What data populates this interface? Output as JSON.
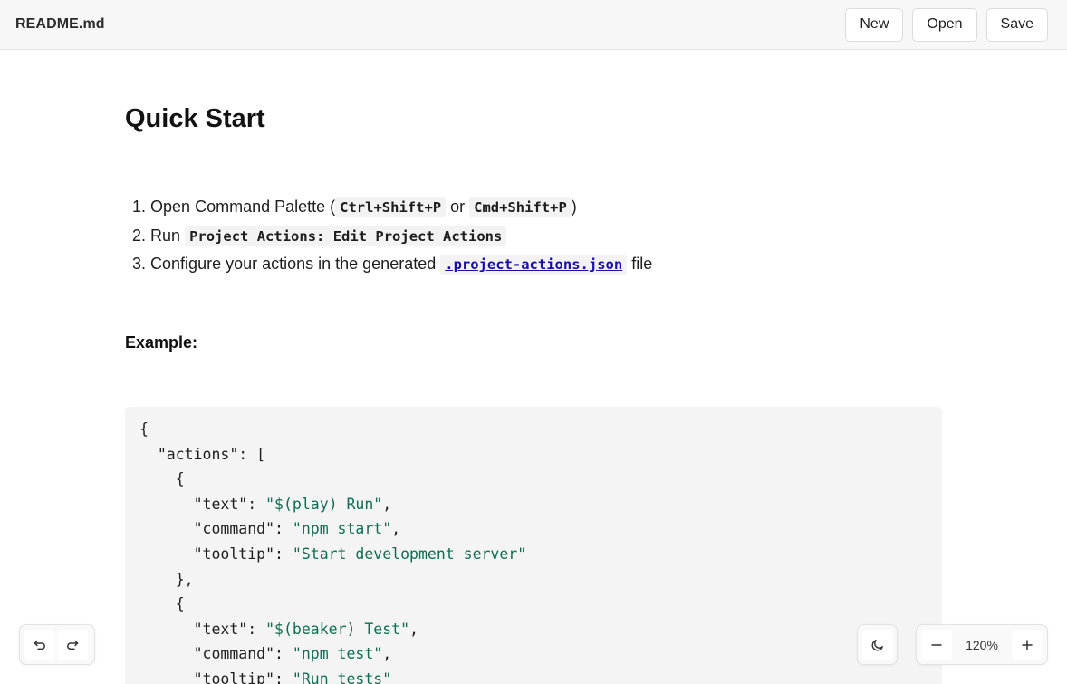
{
  "header": {
    "file_title": "README.md",
    "buttons": {
      "new": "New",
      "open": "Open",
      "save": "Save"
    }
  },
  "doc": {
    "heading": "Quick Start",
    "steps": [
      {
        "num": "1.",
        "pre": "Open Command Palette (",
        "code1": "Ctrl+Shift+P",
        "mid": " or ",
        "code2": "Cmd+Shift+P",
        "post": ")"
      },
      {
        "num": "2.",
        "pre": "Run ",
        "code1": "Project Actions: Edit Project Actions"
      },
      {
        "num": "3.",
        "pre": "Configure your actions in the generated ",
        "link": ".project-actions.json",
        "post": " file"
      }
    ],
    "example_label": "Example:",
    "code": {
      "open_brace": "{",
      "actions_key": "\"actions\"",
      "actions_open": ": [",
      "item_open": "{",
      "item_close_comma": "},",
      "text_key": "\"text\"",
      "command_key": "\"command\"",
      "tooltip_key": "\"tooltip\"",
      "item1": {
        "text": "\"$(play) Run\"",
        "command": "\"npm start\"",
        "tooltip": "\"Start development server\""
      },
      "item2": {
        "text": "\"$(beaker) Test\"",
        "command": "\"npm test\"",
        "tooltip": "\"Run tests\""
      }
    }
  },
  "controls": {
    "zoom_level": "120%",
    "icons": {
      "undo": "undo-icon",
      "redo": "redo-icon",
      "theme": "moon-icon",
      "zoom_out": "minus-icon",
      "zoom_in": "plus-icon"
    }
  },
  "colors": {
    "json_string": "#0f6e51",
    "link": "#1a0dab",
    "code_bg": "#f4f4f4"
  }
}
